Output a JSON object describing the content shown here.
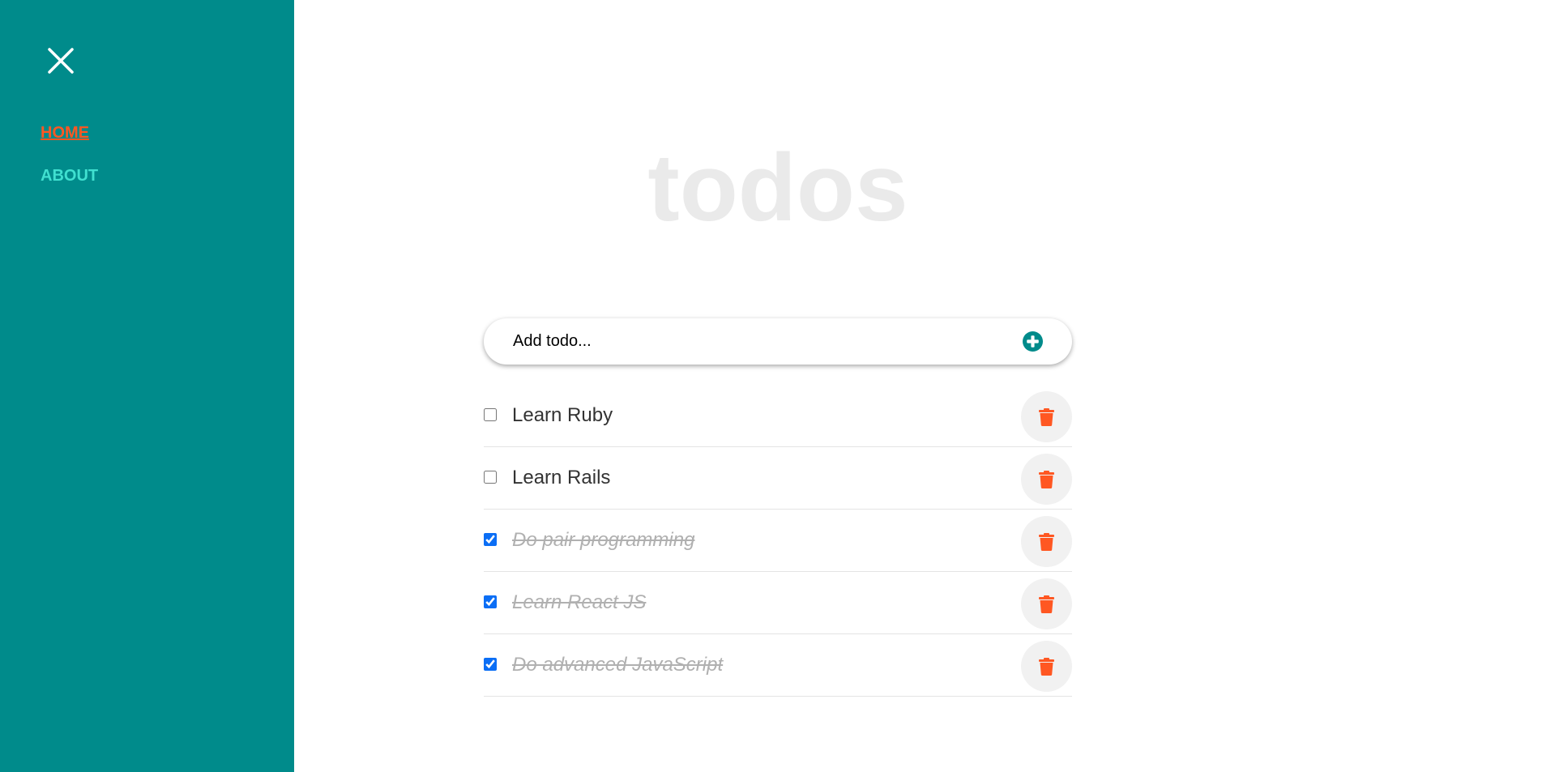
{
  "colors": {
    "sidebar_bg": "#008b8b",
    "nav_active": "#ff5722",
    "nav_inactive": "#40e0d0",
    "title": "#eaeaea",
    "accent": "#008b8b",
    "delete_icon": "#ff5722"
  },
  "sidebar": {
    "close_icon": "close-icon",
    "nav": [
      {
        "label": "HOME",
        "active": true
      },
      {
        "label": "ABOUT",
        "active": false
      }
    ]
  },
  "main": {
    "title": "todos",
    "add_form": {
      "placeholder": "Add todo...",
      "value": "",
      "add_icon": "plus-circle-icon"
    },
    "todos": [
      {
        "text": "Learn Ruby",
        "completed": false,
        "delete_icon": "trash-icon"
      },
      {
        "text": "Learn Rails",
        "completed": false,
        "delete_icon": "trash-icon"
      },
      {
        "text": "Do pair programming",
        "completed": true,
        "delete_icon": "trash-icon"
      },
      {
        "text": "Learn React JS",
        "completed": true,
        "delete_icon": "trash-icon"
      },
      {
        "text": "Do advanced JavaScript",
        "completed": true,
        "delete_icon": "trash-icon"
      }
    ]
  }
}
